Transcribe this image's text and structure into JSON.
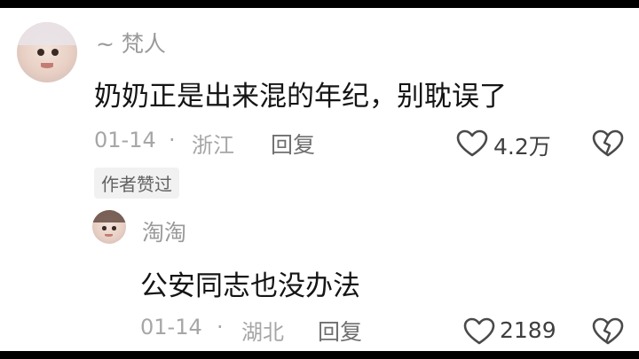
{
  "comment": {
    "username": "~ 梵人",
    "text": "奶奶正是出来混的年纪，别耽误了",
    "date": "01-14",
    "separator": "·",
    "location": "浙江",
    "reply_label": "回复",
    "likes": "4.2万",
    "author_badge": "作者赞过",
    "icons": [
      "heart-icon",
      "dislike-heart-icon"
    ]
  },
  "reply": {
    "username": "淘淘",
    "text": "公安同志也没办法",
    "date": "01-14",
    "separator": "·",
    "location": "湖北",
    "reply_label": "回复",
    "likes": "2189",
    "icons": [
      "heart-icon",
      "dislike-heart-icon"
    ]
  },
  "colors": {
    "background": "#ffffff",
    "letterbox": "#000000",
    "text_primary": "#151515",
    "text_meta": "#a6a6a6"
  }
}
